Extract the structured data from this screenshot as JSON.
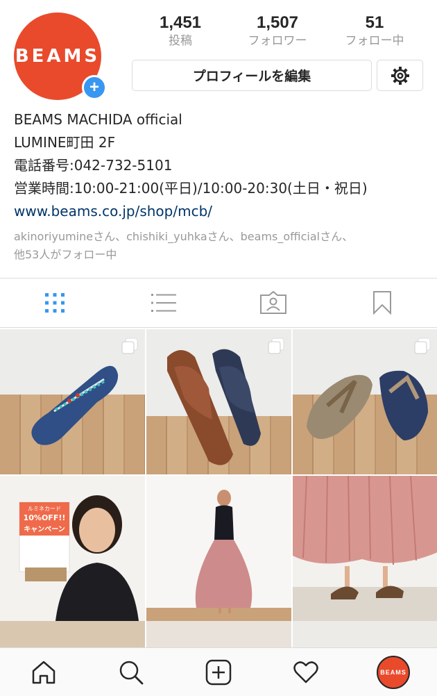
{
  "profile": {
    "avatar_text": "BEAMS",
    "add_symbol": "+",
    "stats": [
      {
        "value": "1,451",
        "label": "投稿"
      },
      {
        "value": "1,507",
        "label": "フォロワー"
      },
      {
        "value": "51",
        "label": "フォロー中"
      }
    ],
    "edit_button_label": "プロフィールを編集",
    "settings_icon": "gear-icon"
  },
  "bio": {
    "name": "BEAMS MACHIDA official",
    "lines": [
      "LUMINE町田 2F",
      "電話番号:042-732-5101",
      "営業時間:10:00-21:00(平日)/10:00-20:30(土日・祝日)"
    ],
    "link": "www.beams.co.jp/shop/mcb/",
    "followed_by_line1": "akinoriyumineさん、chishiki_yuhkaさん、beams_officialさん、",
    "followed_by_line2": "他53人がフォロー中"
  },
  "tabs": [
    {
      "icon": "grid-icon",
      "active": true
    },
    {
      "icon": "list-icon",
      "active": false
    },
    {
      "icon": "tagged-icon",
      "active": false
    },
    {
      "icon": "bookmark-icon",
      "active": false
    }
  ],
  "grid_posts": [
    {
      "subject": "blue sandal",
      "multi": true
    },
    {
      "subject": "suede slides",
      "multi": true
    },
    {
      "subject": "flip flops",
      "multi": true
    },
    {
      "subject": "woman with sign",
      "multi": false,
      "sign_line1": "ルミネカード",
      "sign_line2": "10%OFF!!",
      "sign_line3": "キャンペーン"
    },
    {
      "subject": "pleated skirt outfit",
      "multi": false
    },
    {
      "subject": "pink skirt and sandals",
      "multi": false
    }
  ],
  "bottom_nav": {
    "items": [
      "home-icon",
      "search-icon",
      "new-post-icon",
      "activity-icon",
      "profile-icon"
    ],
    "profile_avatar_text": "BEAMS"
  },
  "colors": {
    "brand": "#e94a2c",
    "accent": "#3897f0",
    "link": "#003569"
  }
}
